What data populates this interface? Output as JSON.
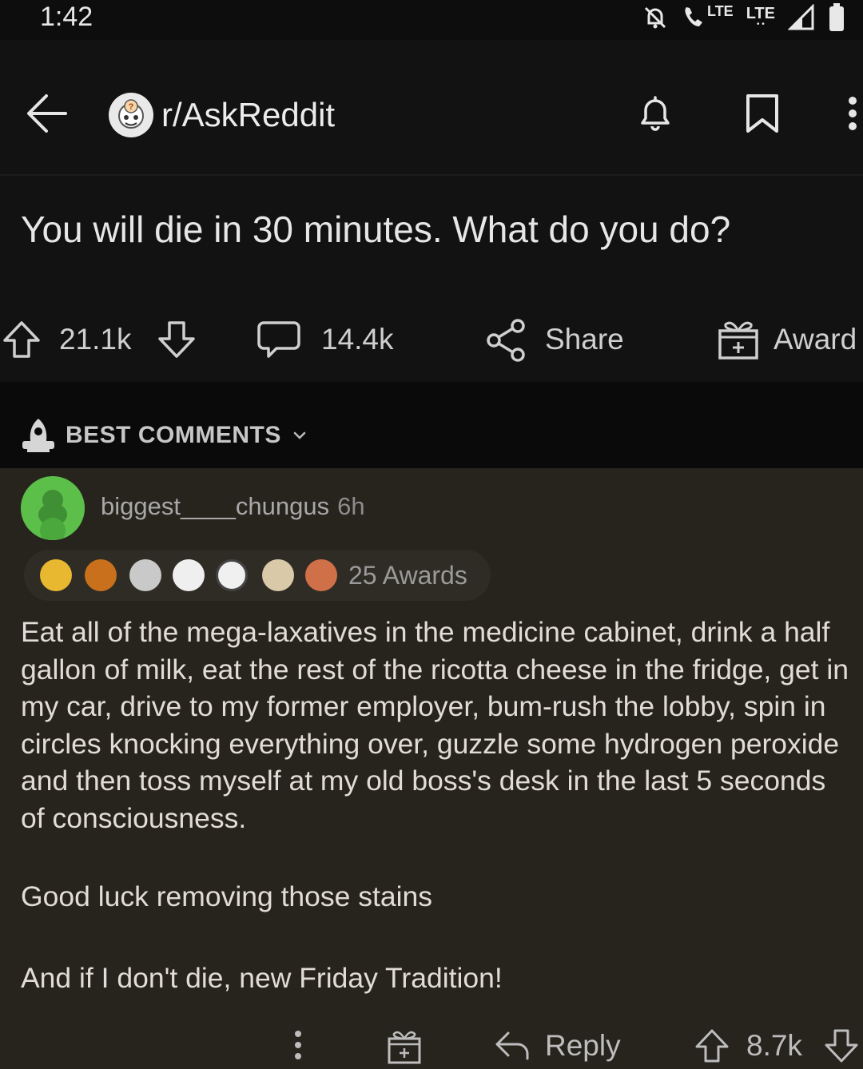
{
  "status_bar": {
    "time": "1:42",
    "lte_small": "LTE",
    "lte_large": "LTE",
    "icons": [
      "mute-bell-icon",
      "wifi-call-icon",
      "signal-icon",
      "battery-icon"
    ]
  },
  "header": {
    "subreddit": "r/AskReddit",
    "icons": [
      "back-arrow-icon",
      "subreddit-avatar-icon",
      "bell-icon",
      "bookmark-icon",
      "more-vertical-icon"
    ]
  },
  "post": {
    "title": "You will die in 30 minutes. What do you do?",
    "votes": "21.1k",
    "comments": "14.4k",
    "share_label": "Share",
    "award_label": "Award"
  },
  "sort": {
    "label": "BEST COMMENTS"
  },
  "comment": {
    "author": "biggest____chungus",
    "age": "6h",
    "awards_count": "25 Awards",
    "award_colors": [
      "#e8b830",
      "#c8701c",
      "#c9c9c9",
      "#efefef",
      "#f0f0f0",
      "#d9c9a8",
      "#d07048"
    ],
    "paragraph_1": "Eat all of the mega-laxatives in the medicine cabinet, drink a half gallon of milk, eat the rest of the ricotta cheese in the fridge, get in my car, drive to my former employer, bum-rush the lobby, spin in circles knocking everything over, guzzle some hydrogen peroxide and then toss myself at my old boss's desk in the last 5 seconds of consciousness.",
    "paragraph_2": "Good luck removing those stains",
    "paragraph_3": "And if I don't die, new Friday Tradition!",
    "reply_label": "Reply",
    "votes": "8.7k"
  },
  "colors": {
    "background": "#121212",
    "comment_background": "#27241e",
    "avatar_green": "#5bbf4a"
  }
}
